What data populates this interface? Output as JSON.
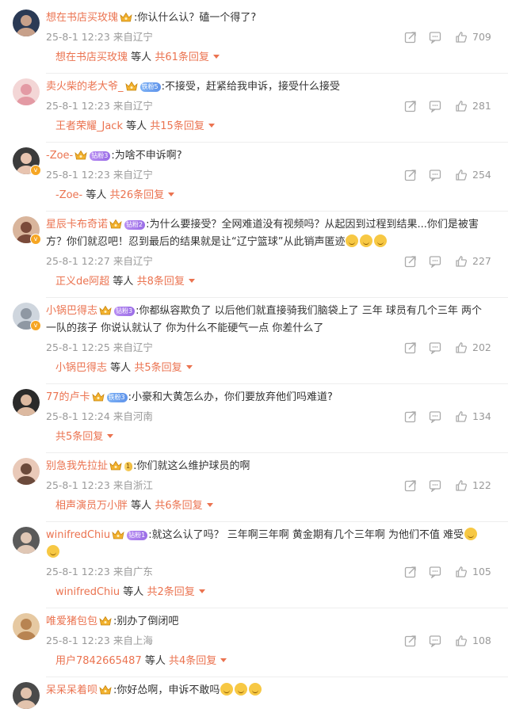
{
  "comments": [
    {
      "avatar_icon": "user-avatar-icon",
      "name": "想在书店买玫瑰",
      "badge": {
        "type": "crown",
        "label": ""
      },
      "text": ":你认什么认？磕一个得了?",
      "emojis": 0,
      "date": "25-8-1 12:23",
      "location": "来自辽宁",
      "likes": "709",
      "reply_name": "想在书店买玫瑰",
      "reply_mid": "等人",
      "reply_count": "共61条回复"
    },
    {
      "avatar_icon": "pig-avatar-icon",
      "name": "卖火柴的老大爷_",
      "badge": {
        "type": "fan-blue",
        "label": "铁粉5"
      },
      "text": ":不接受，赶紧给我申诉，接受什么接受",
      "emojis": 0,
      "date": "25-8-1 12:23",
      "location": "来自辽宁",
      "likes": "281",
      "reply_name": "王者荣耀_Jack",
      "reply_mid": "等人",
      "reply_count": "共15条回复"
    },
    {
      "avatar_icon": "user-avatar-icon",
      "name": "-Zoe-",
      "badge": {
        "type": "fan-purple",
        "label": "钻粉3"
      },
      "text": ":为啥不申诉啊?",
      "emojis": 0,
      "date": "25-8-1 12:23",
      "location": "来自辽宁",
      "likes": "254",
      "reply_name": "-Zoe-",
      "reply_mid": "等人",
      "reply_count": "共26条回复"
    },
    {
      "avatar_icon": "user-avatar-icon",
      "name": "星辰卡布奇诺",
      "badge": {
        "type": "fan-purple",
        "label": "钻粉2"
      },
      "text": ":为什么要接受？全网难道没有视频吗？从起因到过程到结果...你们是被害方？你们就忍吧！忍到最后的结果就是让“辽宁篮球”从此销声匿迹",
      "emojis": 3,
      "date": "25-8-1 12:27",
      "location": "来自辽宁",
      "likes": "227",
      "reply_name": "正义de阿超",
      "reply_mid": "等人",
      "reply_count": "共8条回复"
    },
    {
      "avatar_icon": "cat-avatar-icon",
      "name": "小锅巴得志",
      "badge": {
        "type": "fan-purple",
        "label": "钻粉3"
      },
      "text": ":你都纵容欺负了 以后他们就直接骑我们脑袋上了 三年 球员有几个三年 两个一队的孩子 你说认就认了 你为什么不能硬气一点 你差什么了",
      "emojis": 0,
      "date": "25-8-1 12:25",
      "location": "来自辽宁",
      "likes": "202",
      "reply_name": "小锅巴得志",
      "reply_mid": "等人",
      "reply_count": "共5条回复"
    },
    {
      "avatar_icon": "user-avatar-icon",
      "name": "77的卢卡",
      "badge": {
        "type": "fan-blue",
        "label": "铁粉3"
      },
      "text": ":小豪和大黄怎么办，你们要放弃他们吗难道?",
      "emojis": 0,
      "date": "25-8-1 12:24",
      "location": "来自河南",
      "likes": "134",
      "reply_name": "",
      "reply_mid": "",
      "reply_count": "共5条回复"
    },
    {
      "avatar_icon": "user-avatar-icon",
      "name": "别急我先拉扯",
      "badge": {
        "type": "fan-gold",
        "label": "1"
      },
      "text": ":你们就这么维护球员的啊",
      "emojis": 0,
      "date": "25-8-1 12:23",
      "location": "来自浙江",
      "likes": "122",
      "reply_name": "相声演员万小胖",
      "reply_mid": "等人",
      "reply_count": "共6条回复"
    },
    {
      "avatar_icon": "user-avatar-icon",
      "name": "winifredChiu",
      "badge": {
        "type": "fan-purple",
        "label": "钻粉1"
      },
      "text": ":就这么认了吗？ 三年啊三年啊 黄金期有几个三年啊 为他们不值 难受",
      "emojis": 2,
      "date": "25-8-1 12:23",
      "location": "来自广东",
      "likes": "105",
      "reply_name": "winifredChiu",
      "reply_mid": "等人",
      "reply_count": "共2条回复"
    },
    {
      "avatar_icon": "food-avatar-icon",
      "name": "唯爱猪包包",
      "badge": {
        "type": "crown",
        "label": ""
      },
      "text": ":别办了倒闭吧",
      "emojis": 0,
      "date": "25-8-1 12:23",
      "location": "来自上海",
      "likes": "108",
      "reply_name": "用户7842665487",
      "reply_mid": "等人",
      "reply_count": "共4条回复"
    },
    {
      "avatar_icon": "user-avatar-icon",
      "name": "呆呆呆着呗",
      "badge": {
        "type": "crown",
        "label": ""
      },
      "text": ":你好怂啊，申诉不敢吗",
      "emojis": 3,
      "date": "",
      "location": "",
      "likes": "",
      "reply_name": "",
      "reply_mid": "",
      "reply_count": ""
    }
  ],
  "colors": {
    "name": "#eb7350",
    "meta": "#999999",
    "text": "#333333"
  }
}
